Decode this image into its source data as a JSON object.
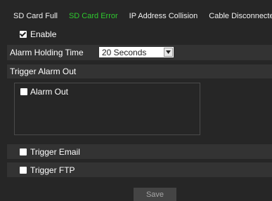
{
  "tabs": [
    {
      "label": "SD Card Full",
      "active": false
    },
    {
      "label": "SD Card Error",
      "active": true
    },
    {
      "label": "IP Address Collision",
      "active": false
    },
    {
      "label": "Cable Disconnected",
      "active": false
    }
  ],
  "enable": {
    "label": "Enable",
    "checked": true
  },
  "alarm_holding": {
    "label": "Alarm Holding Time",
    "value": "20 Seconds"
  },
  "trigger_alarm_out": {
    "label": "Trigger Alarm Out",
    "items": [
      {
        "label": "Alarm Out",
        "checked": false
      }
    ]
  },
  "trigger_email": {
    "label": "Trigger Email",
    "checked": false
  },
  "trigger_ftp": {
    "label": "Trigger FTP",
    "checked": false
  },
  "save_label": "Save",
  "colors": {
    "active_tab": "#2ec92e",
    "background": "#262626",
    "band": "#333333"
  }
}
